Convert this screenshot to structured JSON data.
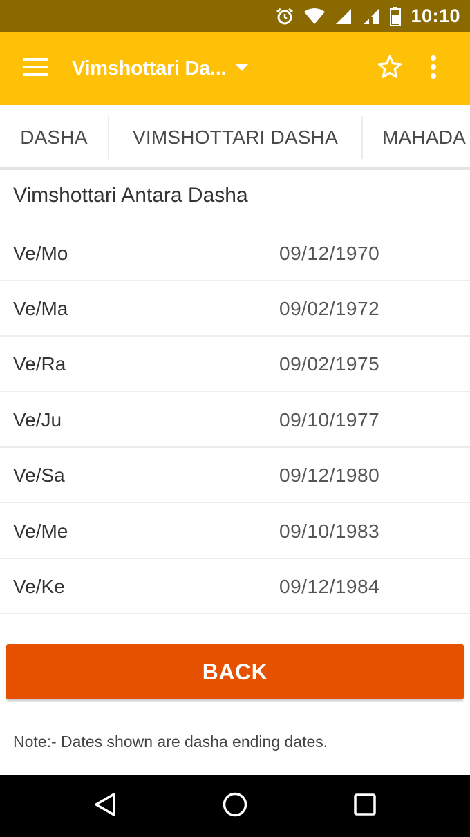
{
  "status_bar": {
    "time": "10:10",
    "icons": [
      "alarm-icon",
      "wifi-icon",
      "signal-icon",
      "signal-icon",
      "battery-icon"
    ]
  },
  "app_bar": {
    "title": "Vimshottari Da...",
    "menu_icon": "hamburger-menu-icon",
    "dropdown_icon": "dropdown-arrow-icon",
    "star_icon": "star-outline-icon",
    "more_icon": "more-vert-icon"
  },
  "tabs": [
    {
      "label": "DASHA",
      "active": false
    },
    {
      "label": "VIMSHOTTARI DASHA",
      "active": true
    },
    {
      "label": "MAHADA",
      "active": false
    }
  ],
  "section_title": "Vimshottari Antara Dasha",
  "rows": [
    {
      "period": "Ve/Mo",
      "date": "09/12/1970"
    },
    {
      "period": "Ve/Ma",
      "date": "09/02/1972"
    },
    {
      "period": "Ve/Ra",
      "date": "09/02/1975"
    },
    {
      "period": "Ve/Ju",
      "date": "09/10/1977"
    },
    {
      "period": "Ve/Sa",
      "date": "09/12/1980"
    },
    {
      "period": "Ve/Me",
      "date": "09/10/1983"
    },
    {
      "period": "Ve/Ke",
      "date": "09/12/1984"
    }
  ],
  "back_button": {
    "label": "BACK",
    "color": "#e65100"
  },
  "note": "Note:- Dates shown are dasha ending dates.",
  "colors": {
    "app_bar": "#ffc107",
    "status_bar": "#8a6a00",
    "tab_indicator": "#f5a623"
  },
  "nav_bar": {
    "back_icon": "nav-back-icon",
    "home_icon": "nav-home-icon",
    "recents_icon": "nav-recents-icon"
  }
}
